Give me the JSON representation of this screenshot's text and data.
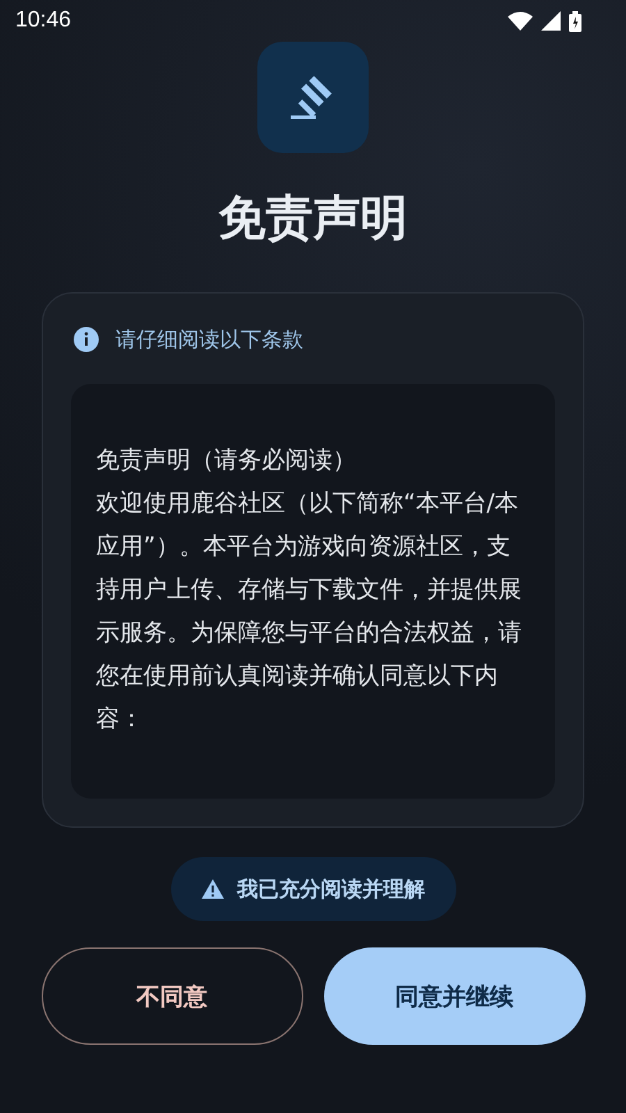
{
  "status_bar": {
    "time": "10:46"
  },
  "title": "免责声明",
  "card": {
    "header": "请仔细阅读以下条款",
    "heading": "免责声明（请务必阅读）",
    "body": "欢迎使用鹿谷社区（以下简称“本平台/本应用”）。本平台为游戏向资源社区，支持用户上传、存储与下载文件，并提供展示服务。为保障您与平台的合法权益，请您在使用前认真阅读并确认同意以下内容："
  },
  "acknowledge": {
    "label": "我已充分阅读并理解"
  },
  "buttons": [
    {
      "label": "不同意",
      "kind": "outline"
    },
    {
      "label": "同意并继续",
      "kind": "filled"
    }
  ]
}
